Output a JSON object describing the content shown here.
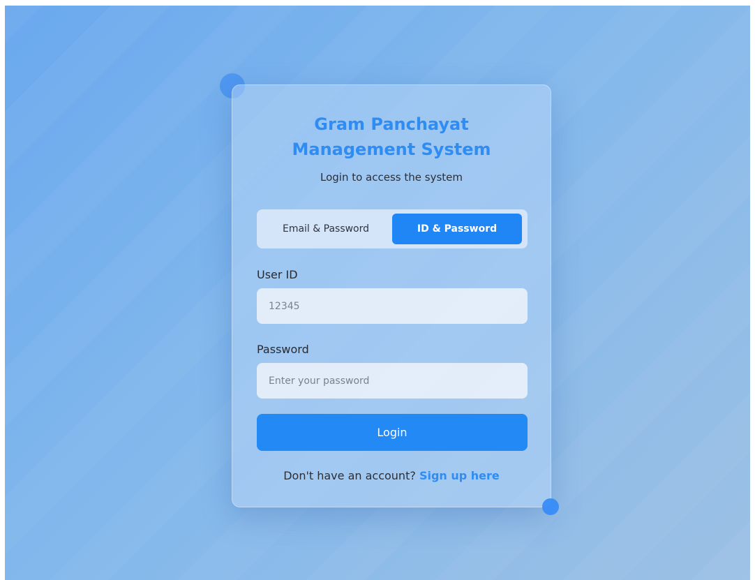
{
  "login": {
    "title_line1": "Gram Panchayat",
    "title_line2": "Management System",
    "subtitle": "Login to access the system",
    "tabs": [
      {
        "label": "Email & Password",
        "active": false
      },
      {
        "label": "ID & Password",
        "active": true
      }
    ],
    "user_id": {
      "label": "User ID",
      "value": "",
      "placeholder": "12345"
    },
    "password": {
      "label": "Password",
      "value": "",
      "placeholder": "Enter your password"
    },
    "submit_label": "Login",
    "signup_prompt": "Don't have an account?",
    "signup_link": "Sign up here"
  },
  "colors": {
    "accent": "#2086f5",
    "title": "#2f8cf2",
    "text": "#2b2f38"
  }
}
